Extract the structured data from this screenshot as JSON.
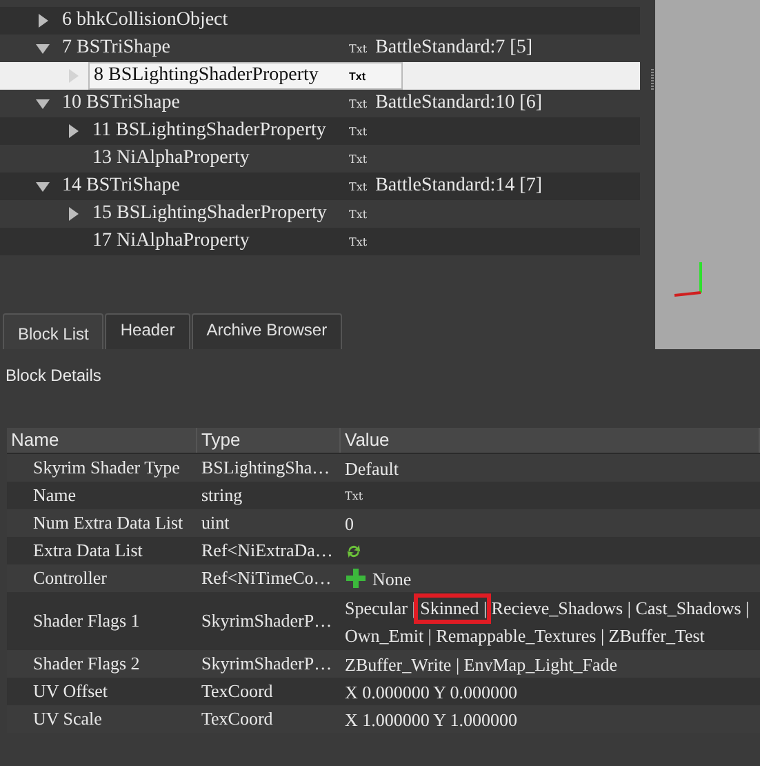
{
  "tree": [
    {
      "label": "6 bhkCollisionObject",
      "expanded": false,
      "selected": false
    },
    {
      "label": "7 BSTriShape",
      "expanded": true,
      "selected": false,
      "icon_text": "Txt",
      "value": "BattleStandard:7 [5]",
      "children": [
        {
          "label": "8 BSLightingShaderProperty",
          "expanded": false,
          "selected": true,
          "icon_text": "Txt"
        }
      ]
    },
    {
      "label": "10 BSTriShape",
      "expanded": true,
      "selected": false,
      "icon_text": "Txt",
      "value": "BattleStandard:10 [6]",
      "children": [
        {
          "label": "11 BSLightingShaderProperty",
          "expanded": false,
          "selected": false,
          "icon_text": "Txt"
        },
        {
          "label": "13 NiAlphaProperty",
          "selected": false,
          "icon_text": "Txt"
        }
      ]
    },
    {
      "label": "14 BSTriShape",
      "expanded": true,
      "selected": false,
      "icon_text": "Txt",
      "value": "BattleStandard:14 [7]",
      "children": [
        {
          "label": "15 BSLightingShaderProperty",
          "expanded": false,
          "selected": false,
          "icon_text": "Txt"
        },
        {
          "label": "17 NiAlphaProperty",
          "selected": false,
          "icon_text": "Txt"
        }
      ]
    }
  ],
  "tabs": [
    {
      "label": "Block List",
      "selected": true
    },
    {
      "label": "Header",
      "selected": false
    },
    {
      "label": "Archive Browser",
      "selected": false
    }
  ],
  "details": {
    "title": "Block Details",
    "columns": [
      "Name",
      "Type",
      "Value"
    ],
    "rows": [
      {
        "name": "Skyrim Shader Type",
        "type": "BSLightingSha…",
        "kind": "text",
        "value": "Default"
      },
      {
        "name": "Name",
        "type": "string",
        "kind": "txt",
        "value": "Txt"
      },
      {
        "name": "Num Extra Data List",
        "type": "uint",
        "kind": "text",
        "value": "0"
      },
      {
        "name": "Extra Data List",
        "type": "Ref<NiExtraDa…",
        "kind": "refresh"
      },
      {
        "name": "Controller",
        "type": "Ref<NiTimeCo…",
        "kind": "add",
        "value": "None"
      },
      {
        "name": "Shader Flags 1",
        "type": "SkyrimShaderP…",
        "kind": "text",
        "value": "Specular | Skinned | Recieve_Shadows | Cast_Shadows | Own_Emit | Remappable_Textures | ZBuffer_Test",
        "highlighted": true
      },
      {
        "name": "Shader Flags 2",
        "type": "SkyrimShaderP…",
        "kind": "text",
        "value": "ZBuffer_Write | EnvMap_Light_Fade"
      },
      {
        "name": "UV Offset",
        "type": "TexCoord",
        "kind": "text",
        "value": "X 0.000000 Y 0.000000"
      },
      {
        "name": "UV Scale",
        "type": "TexCoord",
        "kind": "text",
        "value": "X 1.000000 Y 1.000000"
      }
    ]
  }
}
